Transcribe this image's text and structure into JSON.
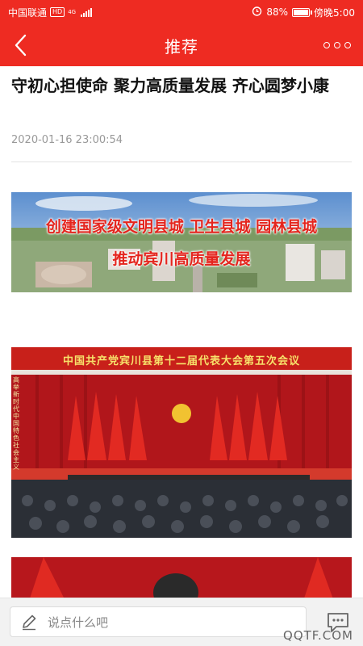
{
  "status_bar": {
    "carrier": "中国联通",
    "hd_badge": "HD",
    "network": "4G",
    "alarm_icon": "alarm-icon",
    "battery_percent": "88%",
    "battery_level": 0.88,
    "time": "傍晚5:00"
  },
  "nav": {
    "back_icon": "chevron-left-icon",
    "title": "推荐",
    "more_icon": "more-icon"
  },
  "article": {
    "title": "守初心担使命 聚力高质量发展 齐心圆梦小康",
    "date": "2020-01-16 23:00:54",
    "images": [
      {
        "name": "banner-photo",
        "lines": [
          "创建国家级文明县城 卫生县城 园林县城",
          "推动宾川高质量发展"
        ]
      },
      {
        "name": "conference-photo",
        "banner": "中国共产党宾川县第十二届代表大会第五次会议",
        "side_text": "高举新时代中国特色社会主义思想伟大旗帜"
      },
      {
        "name": "speaker-photo"
      }
    ]
  },
  "bottom_bar": {
    "comment_placeholder": "说点什么吧",
    "pen_icon": "pen-icon",
    "comment_icon": "comment-bubble-icon",
    "watermark": "QQTF.COM"
  },
  "colors": {
    "brand_red": "#ee2b22",
    "background": "#ffffff",
    "muted_text": "#999999"
  }
}
